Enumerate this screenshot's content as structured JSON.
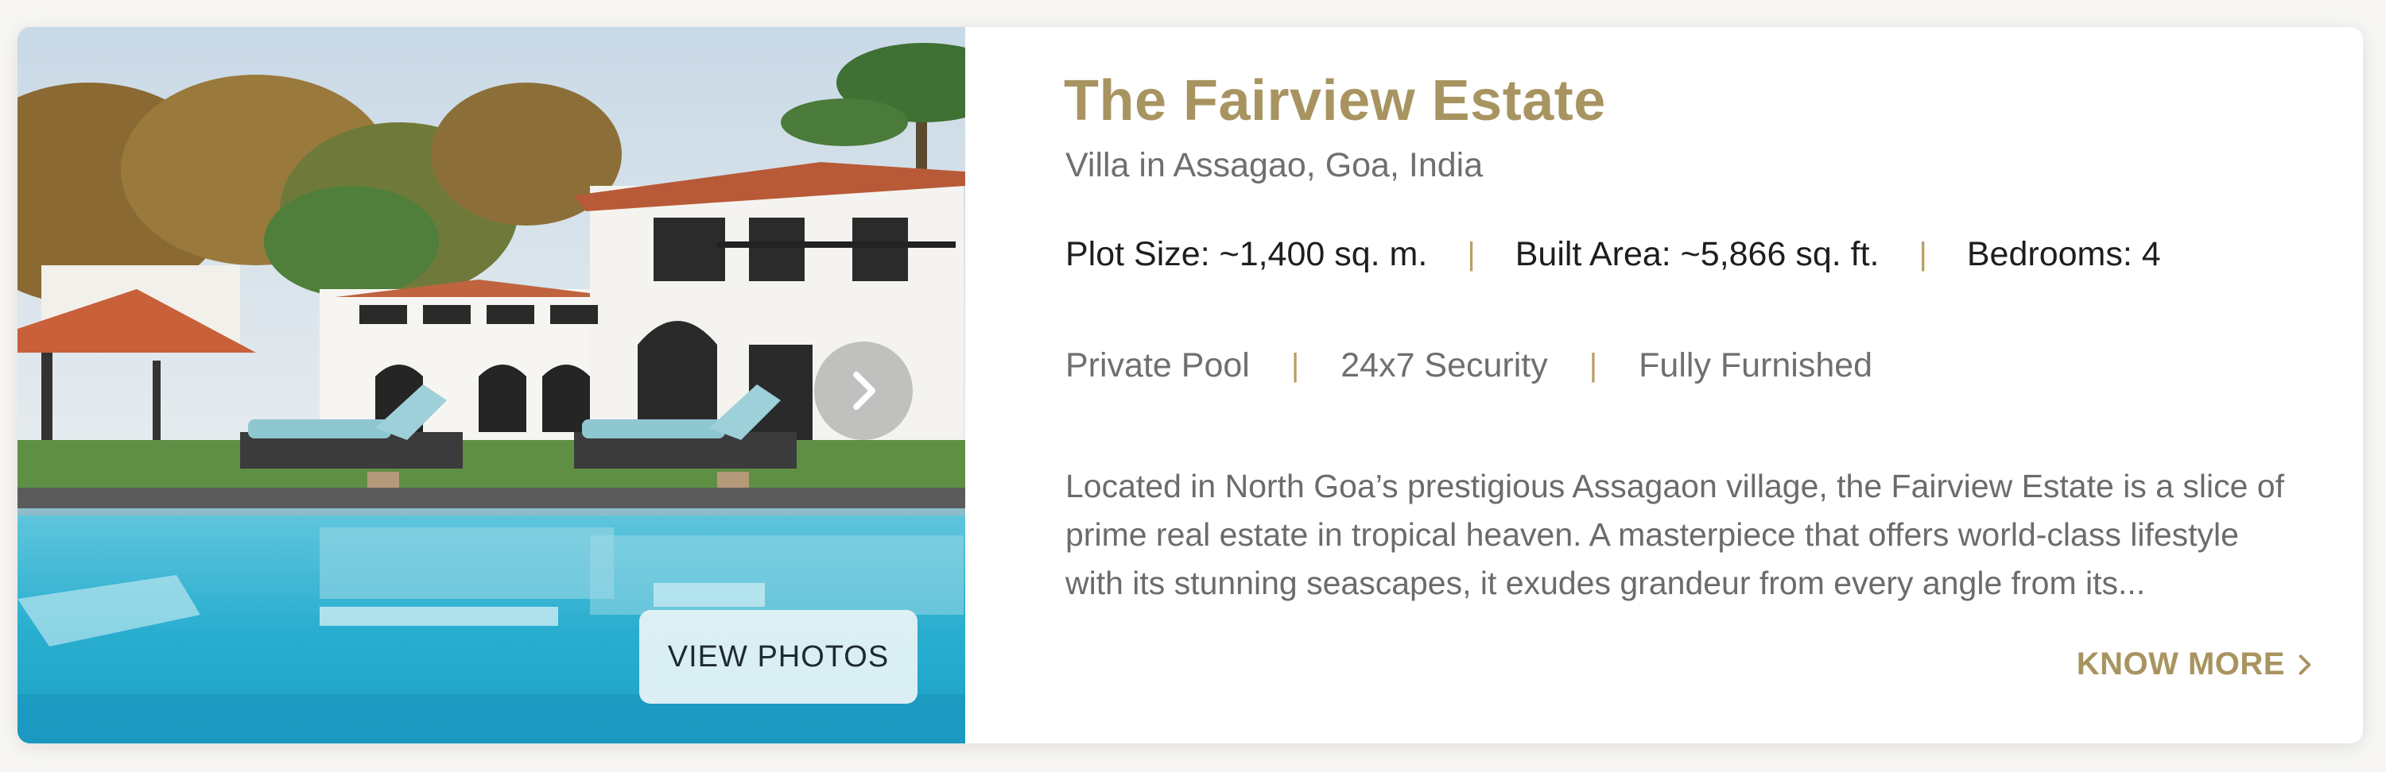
{
  "listing": {
    "title": "The Fairview Estate",
    "location": "Villa in Assagao, Goa, India",
    "specs": {
      "plot_size": "Plot Size: ~1,400 sq. m.",
      "built_area": "Built Area: ~5,866 sq. ft.",
      "bedrooms": "Bedrooms: 4"
    },
    "amenities": [
      "Private Pool",
      "24x7 Security",
      "Fully Furnished"
    ],
    "separator": "|",
    "description": "Located in North Goa’s prestigious Assagaon village, the Fairview Estate is a slice of prime real estate in tropical heaven. A masterpiece that offers world-class lifestyle with its stunning seascapes, it exudes grandeur from every angle from its...",
    "know_more_label": "KNOW MORE"
  },
  "gallery": {
    "view_photos_label": "VIEW PHOTOS",
    "next_icon": "chevron-right-icon"
  },
  "colors": {
    "accent_gold": "#a89460",
    "separator_gold": "#b99e63",
    "text_dark": "#1e1e1e",
    "text_muted": "#6f6f6f",
    "pool_blue": "#2fb2d0"
  }
}
